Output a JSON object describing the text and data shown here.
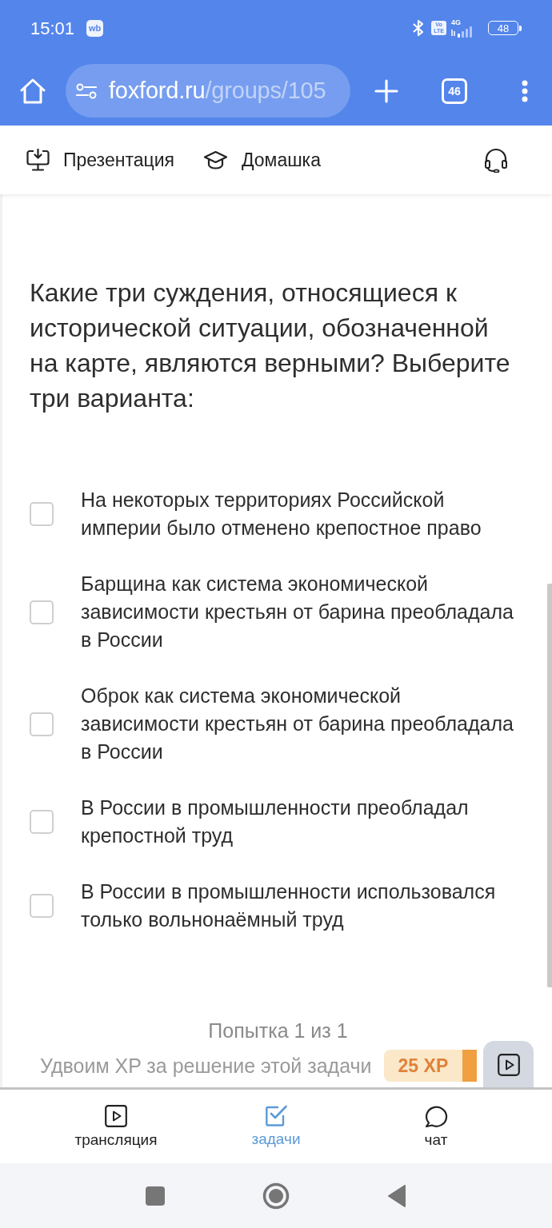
{
  "status_bar": {
    "time": "15:01",
    "app_badge": "wb",
    "volte": "Vo LTE",
    "network": "4G",
    "battery": "48"
  },
  "browser": {
    "url_host": "foxford.ru",
    "url_path": "/groups/105",
    "tab_count": "46"
  },
  "toolbar": {
    "items": [
      {
        "label": "Презентация",
        "kind": "presentation"
      },
      {
        "label": "Домашка",
        "kind": "homework"
      }
    ]
  },
  "question": {
    "text": "Какие три суждения, относящиеся к исторической ситуации, обозначенной на карте, являются верными? Выберите три варианта:",
    "options": [
      {
        "text": "На некоторых территориях Российской империи было отменено крепостное право",
        "checked": false
      },
      {
        "text": "Барщина как система экономической зависимости крестьян от барина преобладала в России",
        "checked": false
      },
      {
        "text": "Оброк как система экономической зависимости крестьян от барина преобладала в России",
        "checked": false
      },
      {
        "text": "В России в промышленности преобладал крепостной труд",
        "checked": false
      },
      {
        "text": "В России в промышленности использовался только вольнонаёмный труд",
        "checked": false
      }
    ]
  },
  "attempt": "Попытка 1 из 1",
  "xp_banner": {
    "text": "Удвоим XP за решение этой задачи",
    "badge": "25 XP"
  },
  "bottom_nav": [
    {
      "label": "трансляция",
      "kind": "broadcast",
      "selected": false
    },
    {
      "label": "задачи",
      "kind": "tasks",
      "selected": true
    },
    {
      "label": "чат",
      "kind": "chat",
      "selected": false
    }
  ]
}
